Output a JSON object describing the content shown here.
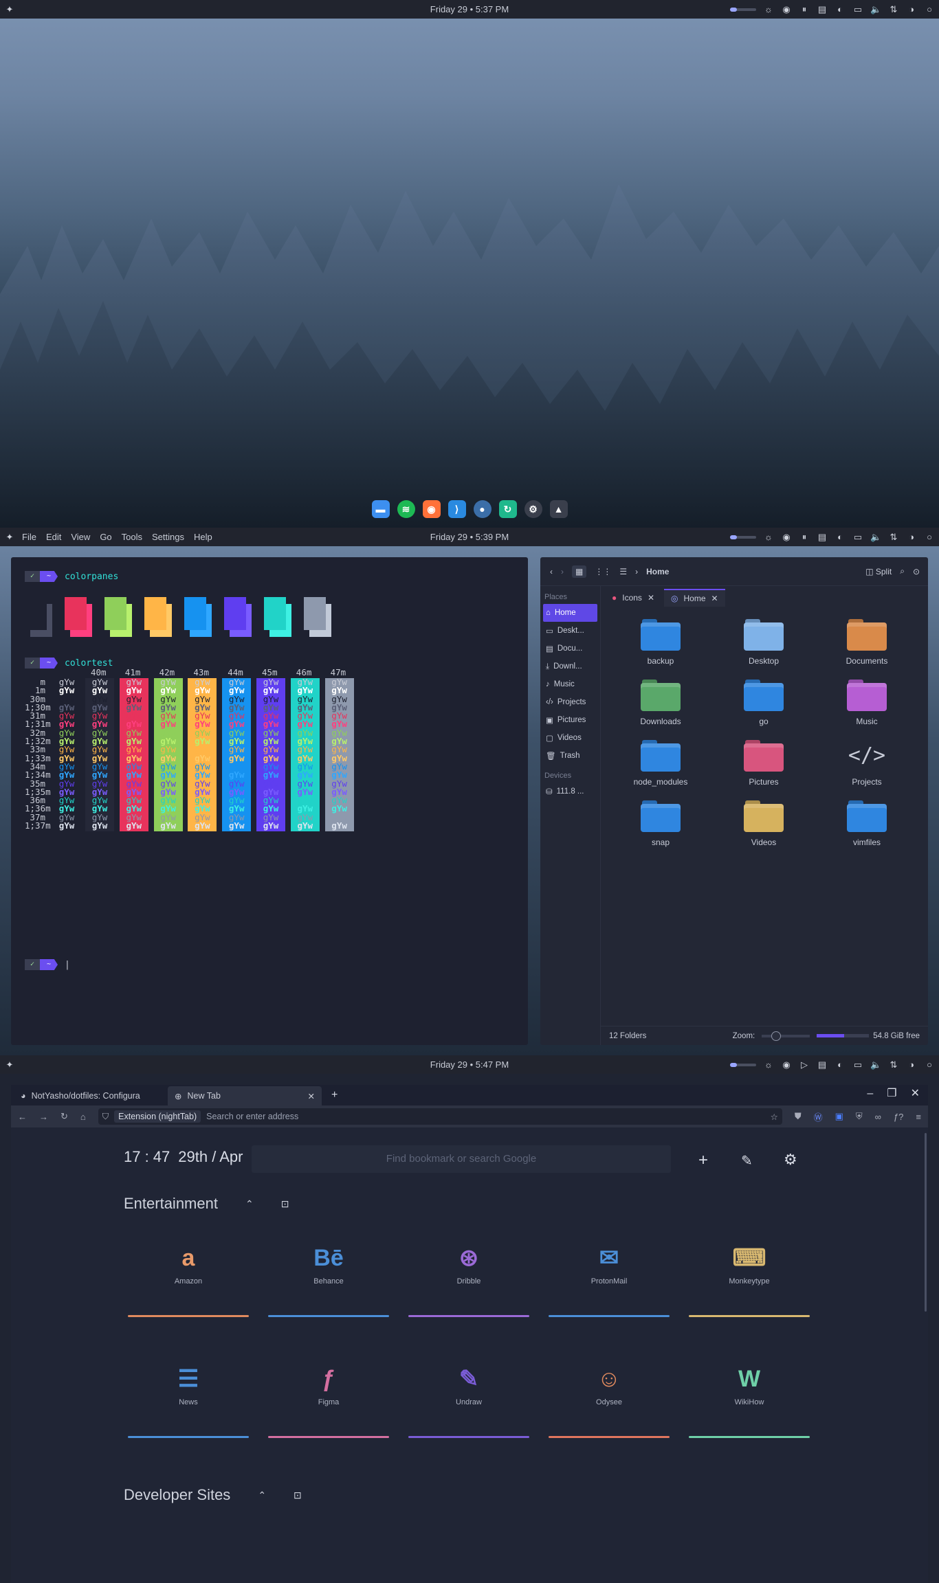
{
  "screen1": {
    "panel": {
      "clock": "Friday 29 • 5:37 PM"
    },
    "dock": [
      {
        "name": "files",
        "color": "#3d8ff0",
        "glyph": "▬"
      },
      {
        "name": "spotify",
        "color": "#1db954",
        "glyph": "≋"
      },
      {
        "name": "firefox",
        "color": "#ff7139",
        "glyph": "◉"
      },
      {
        "name": "vscode",
        "color": "#2a8ae0",
        "glyph": "⟩"
      },
      {
        "name": "steam",
        "color": "#3b6ea8",
        "glyph": "●"
      },
      {
        "name": "sync",
        "color": "#1fb88c",
        "glyph": "↻"
      },
      {
        "name": "system",
        "color": "#3a3f4c",
        "glyph": "⚙"
      },
      {
        "name": "inkscape",
        "color": "#3a3f4c",
        "glyph": "▲"
      }
    ]
  },
  "screen2": {
    "panel": {
      "clock": "Friday 29 • 5:39 PM",
      "menus": [
        "File",
        "Edit",
        "View",
        "Go",
        "Tools",
        "Settings",
        "Help"
      ]
    },
    "terminal": {
      "prompt_check": "✓",
      "prompt_dir": "~",
      "cmd1": "colorpanes",
      "cmd2": "colortest",
      "panes": [
        {
          "front": "#1e2130",
          "back": "#4a4e63"
        },
        {
          "front": "#e8335c",
          "back": "#ff3f7f"
        },
        {
          "front": "#8fcf5a",
          "back": "#b8f06d"
        },
        {
          "front": "#ffb547",
          "back": "#ffc966"
        },
        {
          "front": "#1692f0",
          "back": "#2fa7ff"
        },
        {
          "front": "#5f3ef0",
          "back": "#7a5cff"
        },
        {
          "front": "#21d3c8",
          "back": "#3ef0e3"
        },
        {
          "front": "#8e99ad",
          "back": "#c2cad8"
        }
      ],
      "bg_headers": [
        "40m",
        "41m",
        "42m",
        "43m",
        "44m",
        "45m",
        "46m",
        "47m"
      ],
      "row_labels": [
        "m",
        "1m",
        "30m",
        "1;30m",
        "31m",
        "1;31m",
        "32m",
        "1;32m",
        "33m",
        "1;33m",
        "34m",
        "1;34m",
        "35m",
        "1;35m",
        "36m",
        "1;36m",
        "37m",
        "1;37m"
      ],
      "sample": "gYw",
      "fg_colors": [
        "#c9ccd6",
        "#ffffff",
        "#1e2130",
        "#5b6078",
        "#e8335c",
        "#ff3f7f",
        "#8fcf5a",
        "#b8f06d",
        "#ffb547",
        "#ffc966",
        "#1692f0",
        "#2fa7ff",
        "#5f3ef0",
        "#7a5cff",
        "#21d3c8",
        "#3ef0e3",
        "#8e99ad",
        "#dde3ee"
      ],
      "bg_colors": [
        "#252838",
        "#e8335c",
        "#8fcf5a",
        "#ffb547",
        "#1692f0",
        "#5f3ef0",
        "#21d3c8",
        "#8e99ad"
      ]
    },
    "filemanager": {
      "breadcrumb": "Home",
      "split_label": "Split",
      "places_label": "Places",
      "places": [
        "Home",
        "Deskt...",
        "Docu...",
        "Downl...",
        "Music",
        "Projects",
        "Pictures",
        "Videos",
        "Trash"
      ],
      "places_icons": [
        "⌂",
        "▭",
        "▤",
        "⤓",
        "♪",
        "‹/›",
        "▣",
        "▢",
        "🗑"
      ],
      "devices_label": "Devices",
      "device": "111.8 ...",
      "tabs": [
        "Icons",
        "Home"
      ],
      "folders": [
        {
          "name": "backup",
          "color": "#2f86e0",
          "badge": ""
        },
        {
          "name": "Desktop",
          "color": "#7fb2e8",
          "badge": ""
        },
        {
          "name": "Documents",
          "color": "#d98a4a",
          "badge": ""
        },
        {
          "name": "Downloads",
          "color": "#5aa86a",
          "badge": ""
        },
        {
          "name": "go",
          "color": "#2f86e0",
          "badge": ""
        },
        {
          "name": "Music",
          "color": "#b65ed3",
          "badge": ""
        },
        {
          "name": "node_modules",
          "color": "#2f86e0",
          "badge": ""
        },
        {
          "name": "Pictures",
          "color": "#d8557e",
          "badge": ""
        },
        {
          "name": "Projects",
          "color": "",
          "badge": "</>"
        },
        {
          "name": "snap",
          "color": "#2f86e0",
          "badge": ""
        },
        {
          "name": "Videos",
          "color": "#d6b25e",
          "badge": ""
        },
        {
          "name": "vimfiles",
          "color": "#2f86e0",
          "badge": ""
        }
      ],
      "status_left": "12 Folders",
      "zoom_label": "Zoom:",
      "free": "54.8 GiB free"
    }
  },
  "screen3": {
    "panel": {
      "clock": "Friday 29 • 5:47 PM"
    },
    "browser": {
      "tabs": [
        {
          "label": "NotYasho/dotfiles: Configura"
        },
        {
          "label": "New Tab"
        }
      ],
      "extension_label": "Extension (nightTab)",
      "address_placeholder": "Search or enter address",
      "newtab": {
        "time": "17 : 47",
        "date": "29th / Apr",
        "search_placeholder": "Find bookmark or search Google",
        "groups": [
          "Entertainment",
          "Developer Sites"
        ],
        "bookmarks": [
          {
            "label": "Amazon",
            "glyph": "a",
            "color": "#e89a6a",
            "bar": "#e08a5e"
          },
          {
            "label": "Behance",
            "glyph": "Bē",
            "color": "#4b8fd8",
            "bar": "#4b8fd8"
          },
          {
            "label": "Dribble",
            "glyph": "⊛",
            "color": "#9b6ad6",
            "bar": "#9b6ad6"
          },
          {
            "label": "ProtonMail",
            "glyph": "✉",
            "color": "#4b8fd8",
            "bar": "#4b8fd8"
          },
          {
            "label": "Monkeytype",
            "glyph": "⌨",
            "color": "#d8b870",
            "bar": "#d8b870"
          },
          {
            "label": "News",
            "glyph": "☰",
            "color": "#4b8fd8",
            "bar": "#4b8fd8"
          },
          {
            "label": "Figma",
            "glyph": "ƒ",
            "color": "#d46fa0",
            "bar": "#d46fa0"
          },
          {
            "label": "Undraw",
            "glyph": "✎",
            "color": "#7a5cd6",
            "bar": "#7a5cd6"
          },
          {
            "label": "Odysee",
            "glyph": "☺",
            "color": "#e08a5e",
            "bar": "#e0765e"
          },
          {
            "label": "WikiHow",
            "glyph": "W",
            "color": "#6fd0a8",
            "bar": "#6fd0a8"
          }
        ]
      }
    }
  }
}
